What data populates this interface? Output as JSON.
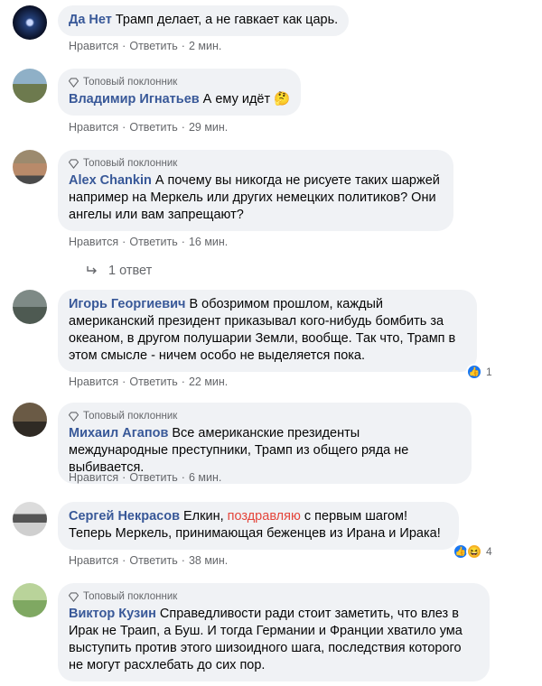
{
  "actions": {
    "like": "Нравится",
    "reply": "Ответить",
    "dot": "·"
  },
  "badge_text": "Топовый поклонник",
  "comments": [
    {
      "author": "Да Нет",
      "text": "Трамп делает, а не гавкает как царь.",
      "time": "2 мин.",
      "badge": false
    },
    {
      "author": "Владимир Игнатьев",
      "text": "А ему идёт 🤔",
      "time": "29 мин.",
      "badge": true
    },
    {
      "author": "Alex Chankin",
      "text": "А почему вы никогда не рисуете таких шаржей например на Меркель или других немецких политиков? Они ангелы или вам запрещают?",
      "time": "16 мин.",
      "badge": true
    },
    {
      "author": "Игорь Георгиевич",
      "text": "В обозримом прошлом, каждый американский президент приказывал кого-нибудь бомбить за океаном, в другом полушарии Земли, вообще. Так что, Трамп в этом смысле - ничем особо не выделяется пока.",
      "time": "22 мин.",
      "badge": false,
      "reactions_count": "1"
    },
    {
      "author": "Михаил Агапов",
      "text": "Все американские президенты международные преступники, Трамп из общего ряда не выбивается.",
      "time": "6 мин.",
      "badge": true
    },
    {
      "author": "Сергей Некрасов",
      "text_before": "Елкин, ",
      "text_highlight": "поздравляю",
      "text_after": " с первым шагом!Теперь Меркель, принимающая беженцев из Ирана и Ирака!",
      "time": "38 мин.",
      "badge": false,
      "reactions_count": "4"
    },
    {
      "author": "Виктор Кузин",
      "text": "Справедливости ради стоит заметить, что влез в Ирак не Траип, а Буш. И тогда Германии и Франции хватило ума выступить против этого шизоидного шага, последствия которого не могут расхлебать до сих пор.",
      "badge": true
    }
  ],
  "replies_label": "1 ответ",
  "colors": {
    "link": "#385898",
    "bubble": "#f0f2f5",
    "muted": "#65676b",
    "highlight": "#e4453b"
  }
}
